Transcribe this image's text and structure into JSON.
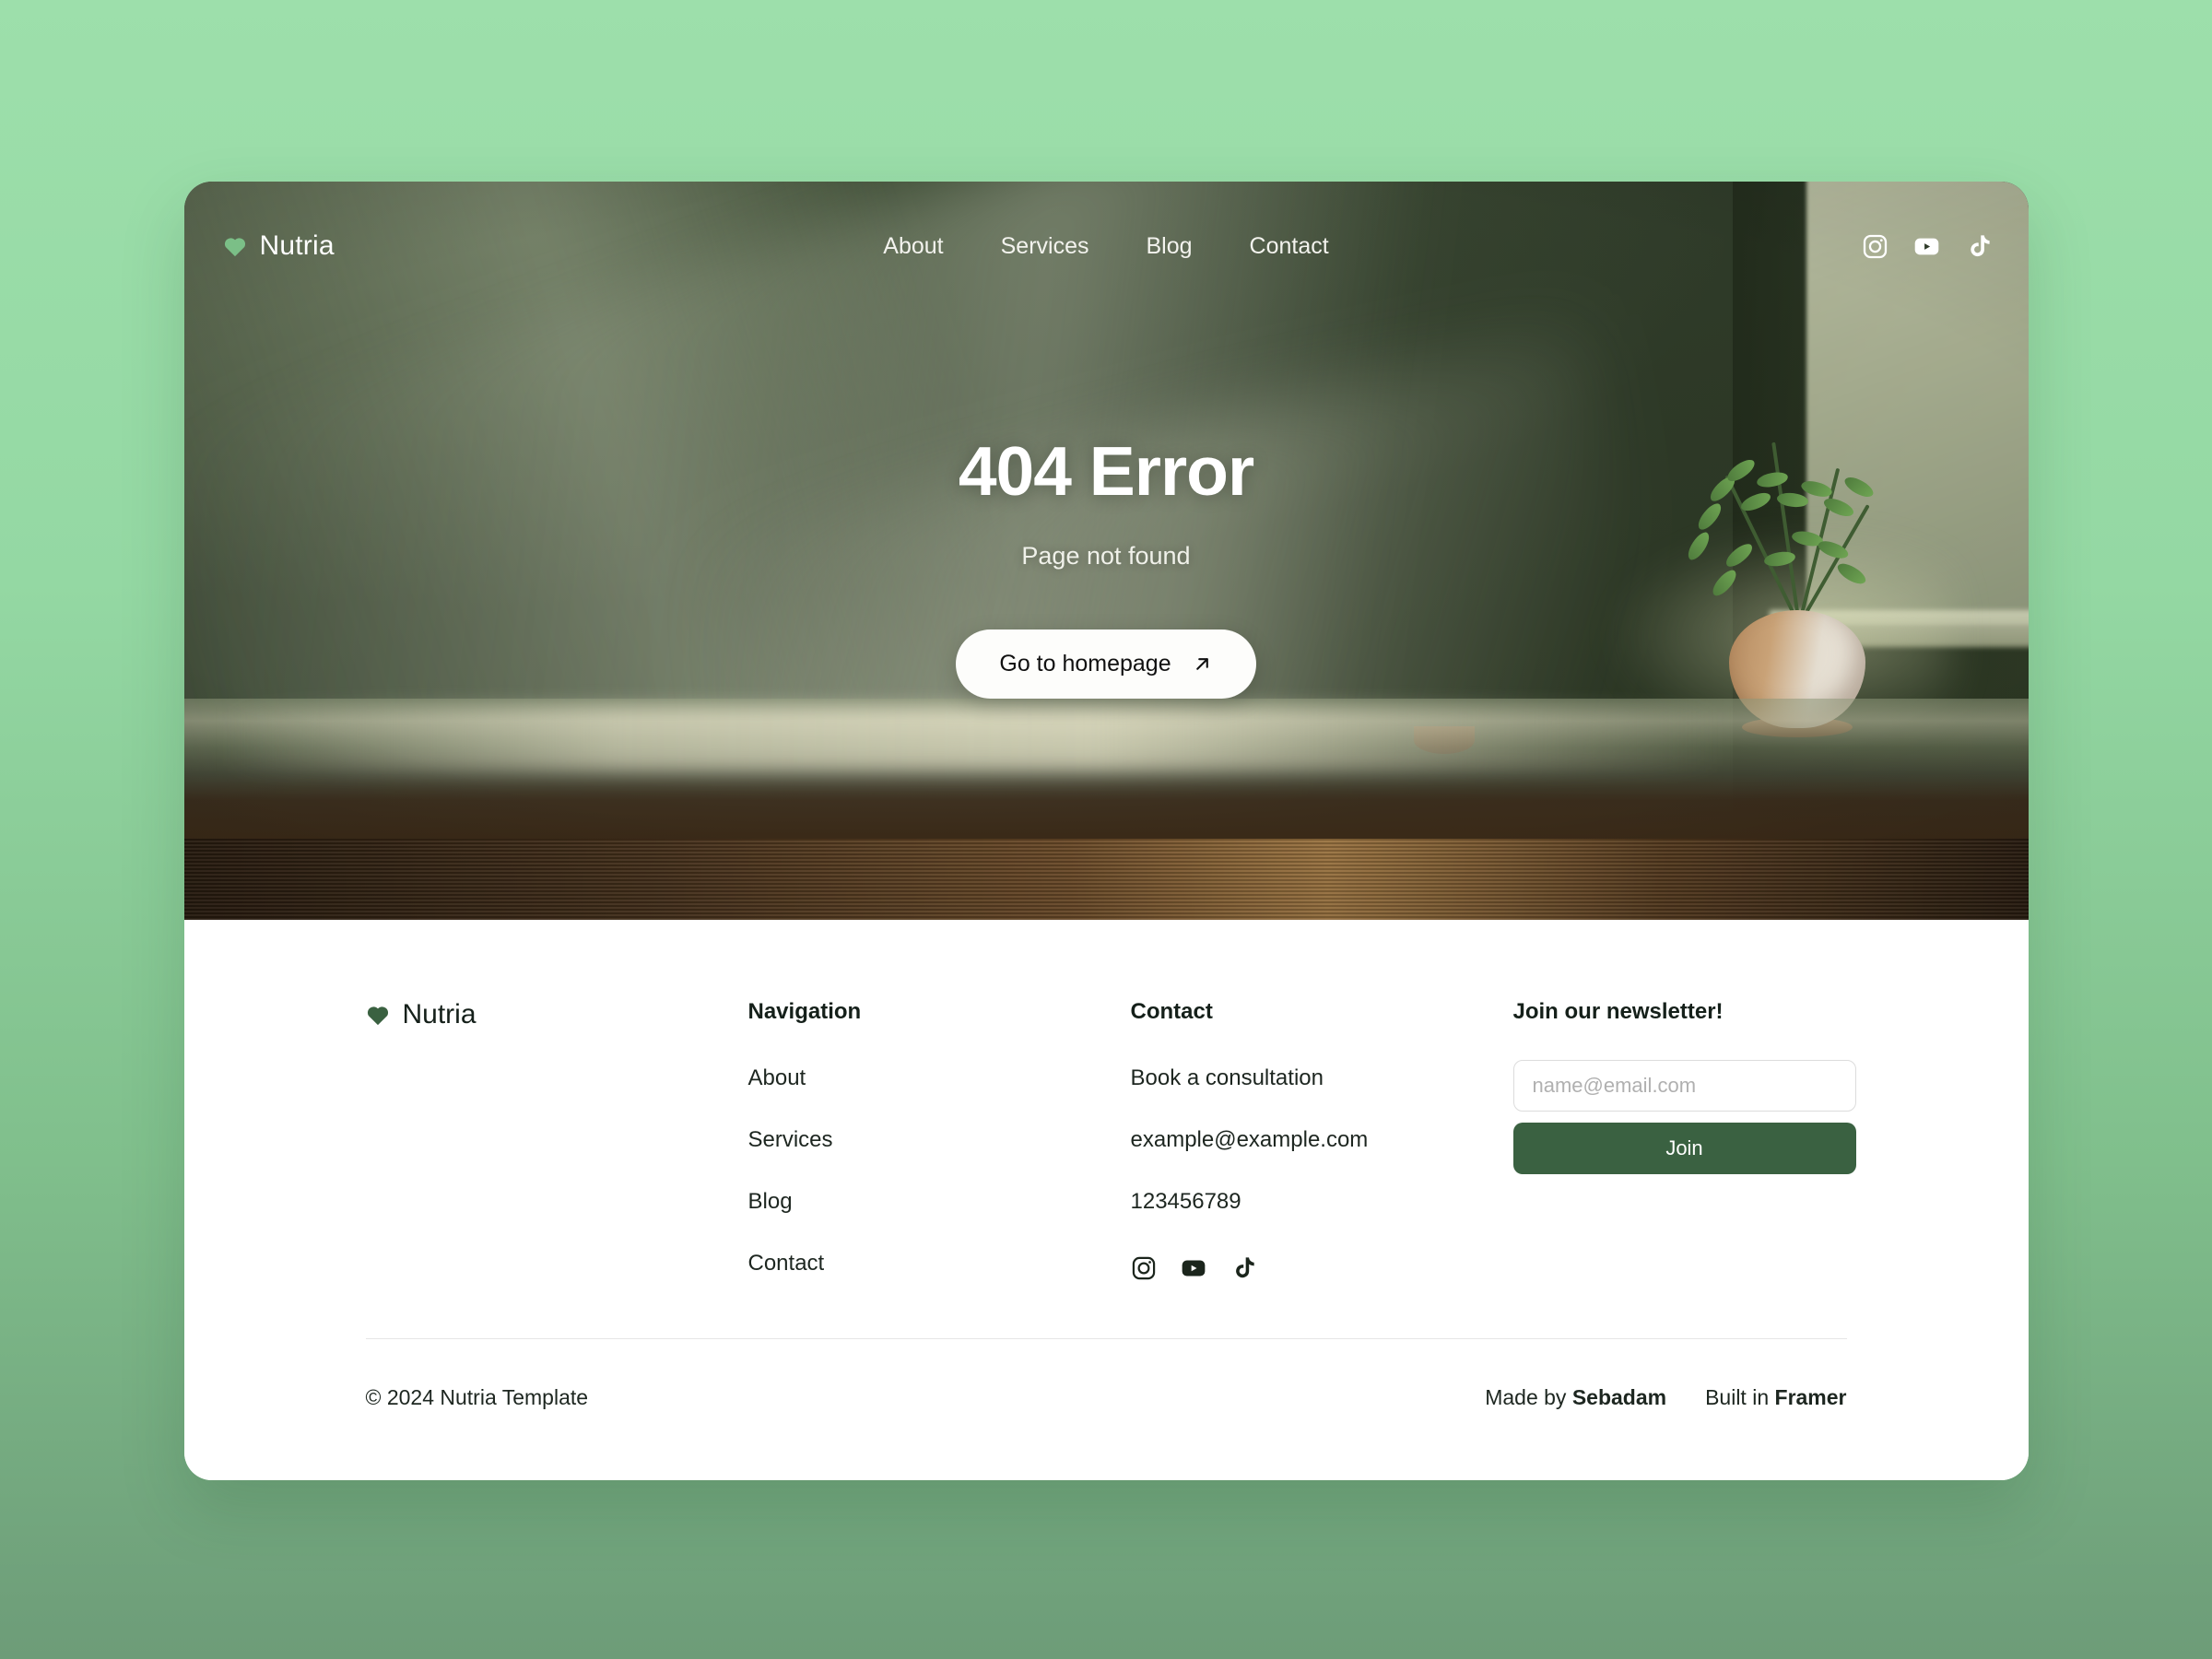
{
  "brand": {
    "name": "Nutria",
    "heart_icon": "heart-icon"
  },
  "nav": {
    "links": [
      {
        "label": "About"
      },
      {
        "label": "Services"
      },
      {
        "label": "Blog"
      },
      {
        "label": "Contact"
      }
    ],
    "social": [
      {
        "name": "instagram-icon"
      },
      {
        "name": "youtube-icon"
      },
      {
        "name": "tiktok-icon"
      }
    ]
  },
  "hero": {
    "title": "404 Error",
    "subtitle": "Page not found",
    "button_label": "Go to homepage",
    "button_icon": "arrow-up-right-icon"
  },
  "footer": {
    "brand_name": "Nutria",
    "navigation": {
      "title": "Navigation",
      "links": [
        {
          "label": "About"
        },
        {
          "label": "Services"
        },
        {
          "label": "Blog"
        },
        {
          "label": "Contact"
        }
      ]
    },
    "contact": {
      "title": "Contact",
      "links": [
        {
          "label": "Book a consultation"
        },
        {
          "label": "example@example.com"
        },
        {
          "label": "123456789"
        }
      ],
      "social": [
        {
          "name": "instagram-icon"
        },
        {
          "name": "youtube-icon"
        },
        {
          "name": "tiktok-icon"
        }
      ]
    },
    "newsletter": {
      "title": "Join our newsletter!",
      "placeholder": "name@email.com",
      "value": "",
      "button_label": "Join"
    },
    "bottom": {
      "copyright": "© 2024 Nutria Template",
      "made_by_prefix": "Made by ",
      "made_by_name": "Sebadam",
      "built_in_prefix": "Built in ",
      "built_in_name": "Framer"
    }
  },
  "colors": {
    "page_bg_top": "#9ddfab",
    "page_bg_bottom": "#6d9c78",
    "brand_green_light": "#7bbf87",
    "brand_green_dark": "#3a6141",
    "hero_wall": "#2f3b29",
    "text_dark": "#15201a",
    "button_white": "#fdfdfb"
  }
}
